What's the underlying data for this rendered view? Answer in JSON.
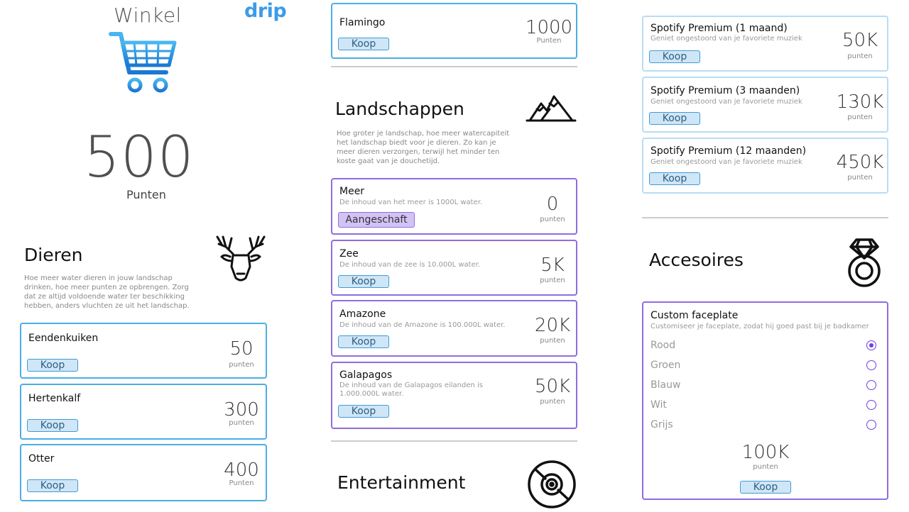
{
  "header": {
    "title": "Winkel",
    "brand": "drip"
  },
  "balance": {
    "value": "500",
    "unit": "Punten"
  },
  "dieren": {
    "title": "Dieren",
    "description": "Hoe meer water dieren in jouw landschap drinken, hoe meer punten ze opbrengen. Zorg dat ze altijd voldoende water ter beschikking hebben, anders vluchten ze uit het landschap.",
    "items": [
      {
        "name": "Eendenkuiken",
        "price": "50",
        "unit": "punten",
        "button": "Koop"
      },
      {
        "name": "Hertenkalf",
        "price": "300",
        "unit": "punten",
        "button": "Koop"
      },
      {
        "name": "Otter",
        "price": "400",
        "unit": "Punten",
        "button": "Koop"
      }
    ]
  },
  "flamingo": {
    "name": "Flamingo",
    "price": "1000",
    "unit": "Punten",
    "button": "Koop"
  },
  "landschappen": {
    "title": "Landschappen",
    "description": "Hoe groter je landschap, hoe meer watercapiteit het landschap biedt voor je dieren. Zo kan je meer dieren verzorgen, terwijl het minder ten koste gaat van je douchetijd.",
    "items": [
      {
        "name": "Meer",
        "desc": "De inhoud van het meer is 1000L water.",
        "price": "0",
        "unit": "punten",
        "button": "Aangeschaft"
      },
      {
        "name": "Zee",
        "desc": "De inhoud van de zee is 10.000L water.",
        "price": "5K",
        "unit": "punten",
        "button": "Koop"
      },
      {
        "name": "Amazone",
        "desc": "De inhoud van de Amazone is 100.000L water.",
        "price": "20K",
        "unit": "punten",
        "button": "Koop"
      },
      {
        "name": "Galapagos",
        "desc": "De inhoud van de Galapagos eilanden is 1.000.000L water.",
        "price": "50K",
        "unit": "punten",
        "button": "Koop"
      }
    ]
  },
  "entertainment": {
    "title": "Entertainment",
    "items": [
      {
        "name": "Spotify Premium (1 maand)",
        "desc": "Geniet ongestoord van je favoriete muziek",
        "price": "50K",
        "unit": "punten",
        "button": "Koop"
      },
      {
        "name": "Spotify Premium (3 maanden)",
        "desc": "Geniet ongestoord van je favoriete muziek",
        "price": "130K",
        "unit": "punten",
        "button": "Koop"
      },
      {
        "name": "Spotify Premium (12 maanden)",
        "desc": "Geniet ongestoord van je favoriete muziek",
        "price": "450K",
        "unit": "punten",
        "button": "Koop"
      }
    ]
  },
  "accessoires": {
    "title": "Accesoires",
    "faceplate": {
      "name": "Custom faceplate",
      "desc": "Customiseer je faceplate, zodat hij goed past bij je badkamer",
      "options": [
        "Rood",
        "Groen",
        "Blauw",
        "Wit",
        "Grijs"
      ],
      "selected": "Rood",
      "price": "100K",
      "unit": "punten",
      "button": "Koop"
    }
  },
  "colors": {
    "accent_blue": "#4aaee6",
    "accent_purple": "#8e6de0",
    "button_fill": "#cfe6f7"
  },
  "icons": [
    "cart-icon",
    "deer-icon",
    "mountain-icon",
    "vinyl-record-icon",
    "diamond-ring-icon"
  ]
}
